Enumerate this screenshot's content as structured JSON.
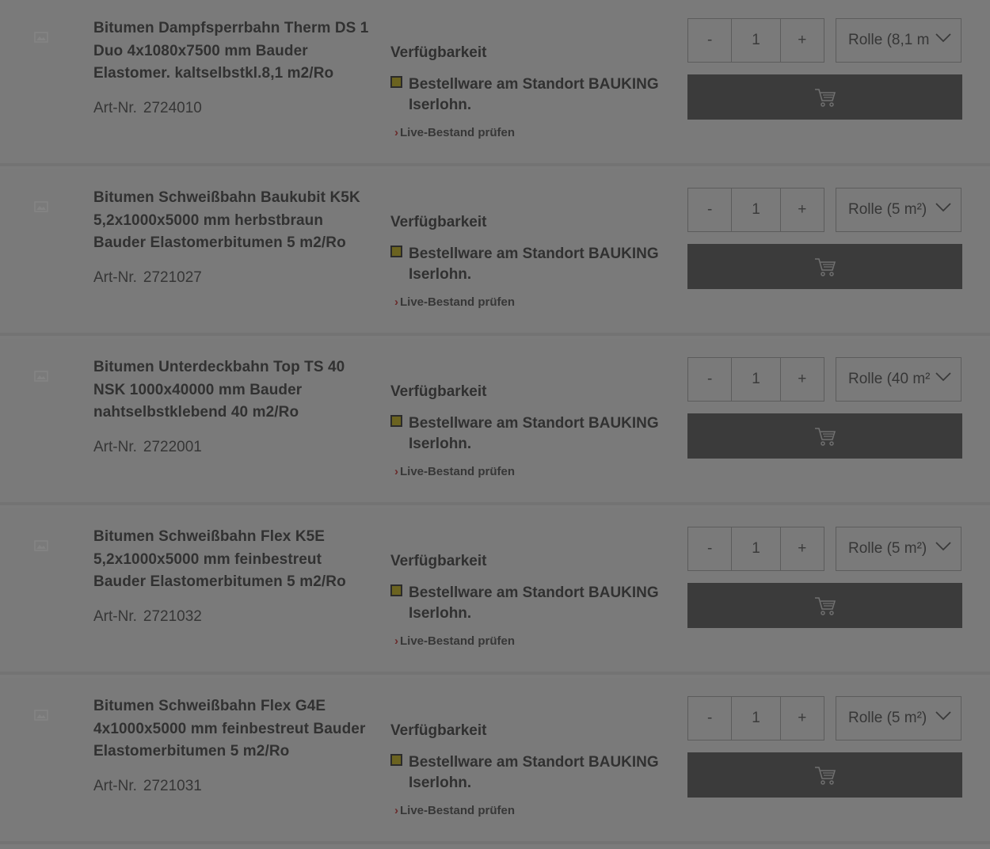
{
  "availability_heading": "Verfügbarkeit",
  "live_stock_label": "Live-Bestand prüfen",
  "artnr_label": "Art-Nr.",
  "qty_minus": "-",
  "qty_plus": "+",
  "colors": {
    "overlay_bg": "#7b7b7b",
    "cart_button": "#3b3b3b",
    "availability_marker": "#6b6320",
    "live_chevron": "#6a2a2a"
  },
  "icons": {
    "thumbnail": "image-placeholder-icon",
    "dropdown": "chevron-down-icon",
    "cart": "cart-icon"
  },
  "products": [
    {
      "title": "Bitumen Dampfsperrbahn Therm DS 1 Duo 4x1080x7500 mm Bauder Elastomer. kaltselbstkl.8,1 m2/Ro",
      "artnr": "2724010",
      "availability": "Bestellware am Standort BAUKING Iserlohn.",
      "quantity": "1",
      "unit": "Rolle (8,1 m"
    },
    {
      "title": "Bitumen Schweißbahn Baukubit K5K 5,2x1000x5000 mm herbstbraun Bauder Elastomerbitumen 5 m2/Ro",
      "artnr": "2721027",
      "availability": "Bestellware am Standort BAUKING Iserlohn.",
      "quantity": "1",
      "unit": "Rolle (5 m²)"
    },
    {
      "title": "Bitumen Unterdeckbahn Top TS 40 NSK 1000x40000 mm Bauder nahtselbstklebend 40 m2/Ro",
      "artnr": "2722001",
      "availability": "Bestellware am Standort BAUKING Iserlohn.",
      "quantity": "1",
      "unit": "Rolle (40 m²"
    },
    {
      "title": "Bitumen Schweißbahn Flex K5E 5,2x1000x5000 mm feinbestreut Bauder Elastomerbitumen 5 m2/Ro",
      "artnr": "2721032",
      "availability": "Bestellware am Standort BAUKING Iserlohn.",
      "quantity": "1",
      "unit": "Rolle (5 m²)"
    },
    {
      "title": "Bitumen Schweißbahn Flex G4E 4x1000x5000 mm feinbestreut Bauder Elastomerbitumen 5 m2/Ro",
      "artnr": "2721031",
      "availability": "Bestellware am Standort BAUKING Iserlohn.",
      "quantity": "1",
      "unit": "Rolle (5 m²)"
    }
  ]
}
